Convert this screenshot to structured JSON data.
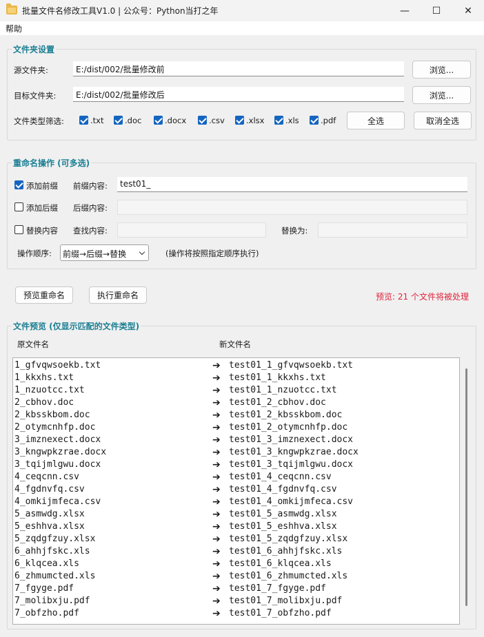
{
  "window": {
    "title": "批量文件名修改工具V1.0 | 公众号：Python当打之年",
    "minimize_glyph": "—",
    "maximize_glyph": "☐",
    "close_glyph": "✕"
  },
  "menu": {
    "help": "帮助"
  },
  "folder_settings": {
    "title": "文件夹设置",
    "source_label": "源文件夹:",
    "source_value": "E:/dist/002/批量修改前",
    "target_label": "目标文件夹:",
    "target_value": "E:/dist/002/批量修改后",
    "browse_label": "浏览...",
    "filter_label": "文件类型筛选:",
    "types": [
      {
        "label": ".txt",
        "checked": true
      },
      {
        "label": ".doc",
        "checked": true
      },
      {
        "label": ".docx",
        "checked": true
      },
      {
        "label": ".csv",
        "checked": true
      },
      {
        "label": ".xlsx",
        "checked": true
      },
      {
        "label": ".xls",
        "checked": true
      },
      {
        "label": ".pdf",
        "checked": true
      }
    ],
    "select_all": "全选",
    "deselect_all": "取消全选"
  },
  "rename_ops": {
    "title": "重命名操作 (可多选)",
    "add_prefix": {
      "label": "添加前缀",
      "checked": true
    },
    "prefix_label": "前缀内容:",
    "prefix_value": "test01_",
    "add_suffix": {
      "label": "添加后缀",
      "checked": false
    },
    "suffix_label": "后缀内容:",
    "suffix_value": "",
    "replace": {
      "label": "替换内容",
      "checked": false
    },
    "find_label": "查找内容:",
    "find_value": "",
    "replace_with_label": "替换为:",
    "replace_with_value": "",
    "order_label": "操作顺序:",
    "order_value": "前缀→后缀→替换",
    "order_hint": "(操作将按照指定顺序执行)"
  },
  "actions": {
    "preview": "预览重命名",
    "execute": "执行重命名",
    "status": "预览: 21 个文件将被处理"
  },
  "preview": {
    "title": "文件预览 (仅显示匹配的文件类型)",
    "col_original": "原文件名",
    "col_new": "新文件名",
    "arrow": "➔",
    "rows": [
      {
        "original": "1_gfvqwsoekb.txt",
        "new": "test01_1_gfvqwsoekb.txt"
      },
      {
        "original": "1_kkxhs.txt",
        "new": "test01_1_kkxhs.txt"
      },
      {
        "original": "1_nzuotcc.txt",
        "new": "test01_1_nzuotcc.txt"
      },
      {
        "original": "2_cbhov.doc",
        "new": "test01_2_cbhov.doc"
      },
      {
        "original": "2_kbsskbom.doc",
        "new": "test01_2_kbsskbom.doc"
      },
      {
        "original": "2_otymcnhfp.doc",
        "new": "test01_2_otymcnhfp.doc"
      },
      {
        "original": "3_imznexect.docx",
        "new": "test01_3_imznexect.docx"
      },
      {
        "original": "3_kngwpkzrae.docx",
        "new": "test01_3_kngwpkzrae.docx"
      },
      {
        "original": "3_tqijmlgwu.docx",
        "new": "test01_3_tqijmlgwu.docx"
      },
      {
        "original": "4_ceqcnn.csv",
        "new": "test01_4_ceqcnn.csv"
      },
      {
        "original": "4_fgdnvfq.csv",
        "new": "test01_4_fgdnvfq.csv"
      },
      {
        "original": "4_omkijmfeca.csv",
        "new": "test01_4_omkijmfeca.csv"
      },
      {
        "original": "5_asmwdg.xlsx",
        "new": "test01_5_asmwdg.xlsx"
      },
      {
        "original": "5_eshhva.xlsx",
        "new": "test01_5_eshhva.xlsx"
      },
      {
        "original": "5_zqdgfzuy.xlsx",
        "new": "test01_5_zqdgfzuy.xlsx"
      },
      {
        "original": "6_ahhjfskc.xls",
        "new": "test01_6_ahhjfskc.xls"
      },
      {
        "original": "6_klqcea.xls",
        "new": "test01_6_klqcea.xls"
      },
      {
        "original": "6_zhmumcted.xls",
        "new": "test01_6_zhmumcted.xls"
      },
      {
        "original": "7_fgyge.pdf",
        "new": "test01_7_fgyge.pdf"
      },
      {
        "original": "7_molibxju.pdf",
        "new": "test01_7_molibxju.pdf"
      },
      {
        "original": "7_obfzho.pdf",
        "new": "test01_7_obfzho.pdf"
      }
    ]
  }
}
